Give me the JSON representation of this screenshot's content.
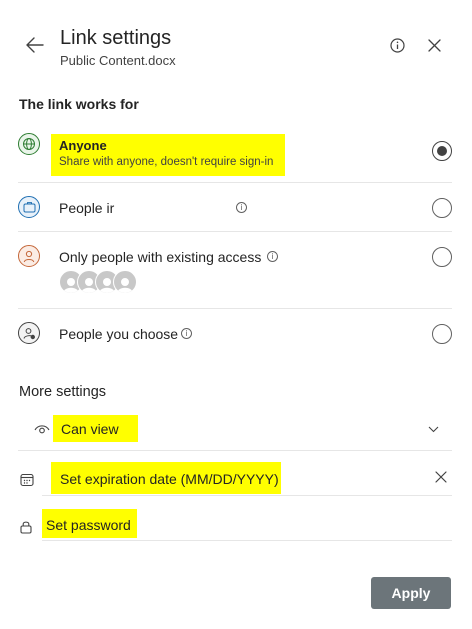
{
  "header": {
    "title": "Link settings",
    "file_name": "Public Content.docx"
  },
  "link_works_for": {
    "heading": "The link works for",
    "options": [
      {
        "label": "Anyone",
        "description": "Share with anyone, doesn't require sign-in",
        "selected": true,
        "icon": "globe-icon"
      },
      {
        "label": "People ir",
        "selected": false,
        "icon": "briefcase-icon"
      },
      {
        "label": "Only people with existing access",
        "selected": false,
        "icon": "person-icon"
      },
      {
        "label": "People you choose",
        "selected": false,
        "icon": "person-settings-icon"
      }
    ]
  },
  "more_settings": {
    "heading": "More settings",
    "permission": "Can view",
    "expiration_placeholder": "Set expiration date (MM/DD/YYYY)",
    "password_placeholder": "Set password"
  },
  "footer": {
    "apply_label": "Apply"
  },
  "colors": {
    "highlight": "#ffff00",
    "apply_button": "#6c757a",
    "globe_accent": "#2e7d32",
    "briefcase_accent": "#1f6fb2",
    "person_accent": "#c4673a"
  }
}
